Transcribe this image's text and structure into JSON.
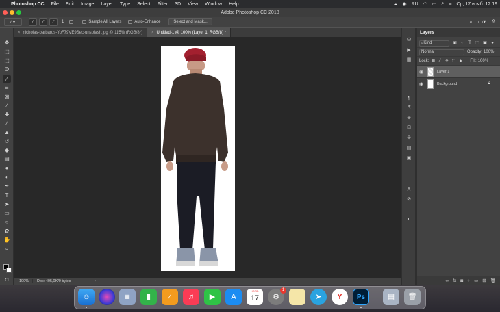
{
  "menubar": {
    "app_name": "Photoshop CC",
    "items": [
      "File",
      "Edit",
      "Image",
      "Layer",
      "Type",
      "Select",
      "Filter",
      "3D",
      "View",
      "Window",
      "Help"
    ],
    "lang": "RU",
    "datetime": "Ср, 17 нояб.  12:19"
  },
  "window": {
    "title": "Adobe Photoshop CC 2018"
  },
  "options": {
    "brush_size": "1",
    "sample_all_layers": "Sample All Layers",
    "auto_enhance": "Auto-Enhance",
    "select_mask": "Select and Mask..."
  },
  "tabs": [
    {
      "label": "nicholas-barbaros-YoF79VE9Sec-unsplash.jpg @ 115% (RGB/8*)"
    },
    {
      "label": "Untitled-1 @ 100% (Layer 1, RGB/8) *"
    }
  ],
  "status": {
    "zoom": "100%",
    "doc": "Doc: 405,0K/0 bytes"
  },
  "layers_panel": {
    "title": "Layers",
    "kind": "Kind",
    "blend_mode": "Normal",
    "opacity_label": "Opacity:",
    "opacity_value": "100%",
    "lock_label": "Lock:",
    "fill_label": "Fill:",
    "fill_value": "100%",
    "layers": [
      {
        "name": "Layer 1",
        "selected": true
      },
      {
        "name": "Background",
        "selected": false
      }
    ]
  },
  "dock": {
    "calendar_month": "НОЯБ.",
    "calendar_day": "17",
    "badge": "1"
  },
  "colors": {
    "accent_red": "#a3202f",
    "panel_bg": "#424242",
    "workspace_bg": "#282828"
  }
}
